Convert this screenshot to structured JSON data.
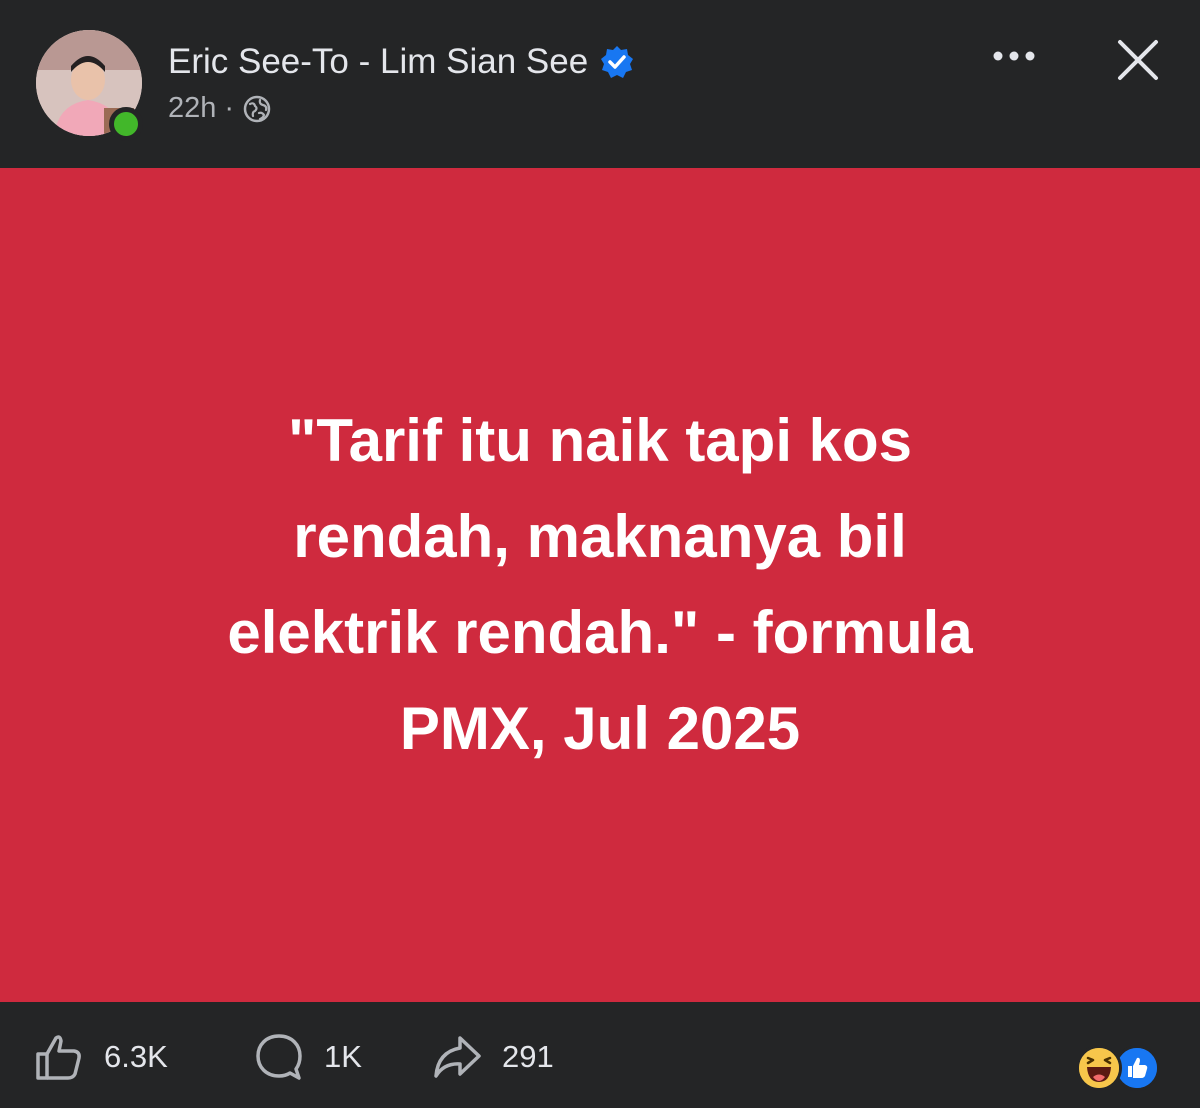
{
  "post": {
    "author": "Eric See-To - Lim Sian See",
    "time": "22h",
    "separator": "·",
    "privacy_icon": "globe-icon",
    "body": "\"Tarif itu naik tapi kos\nrendah,  maknanya bil\nelektrik rendah.\" - formula\nPMX, Jul 2025",
    "background_color": "#cf2a3e"
  },
  "stats": {
    "likes": "6.3K",
    "comments": "1K",
    "shares": "291"
  },
  "icons": {
    "more": "more-dots-icon",
    "close": "close-icon",
    "verified": "verified-badge-icon",
    "like": "thumbs-up-icon",
    "comment": "comment-bubble-icon",
    "share": "share-arrow-icon",
    "reactions": [
      "haha-reaction-icon",
      "like-reaction-icon"
    ]
  },
  "colors": {
    "background": "#242526",
    "text": "#e4e6eb",
    "muted": "#b0b3b8",
    "verified": "#1877f2",
    "online": "#42b72a"
  }
}
